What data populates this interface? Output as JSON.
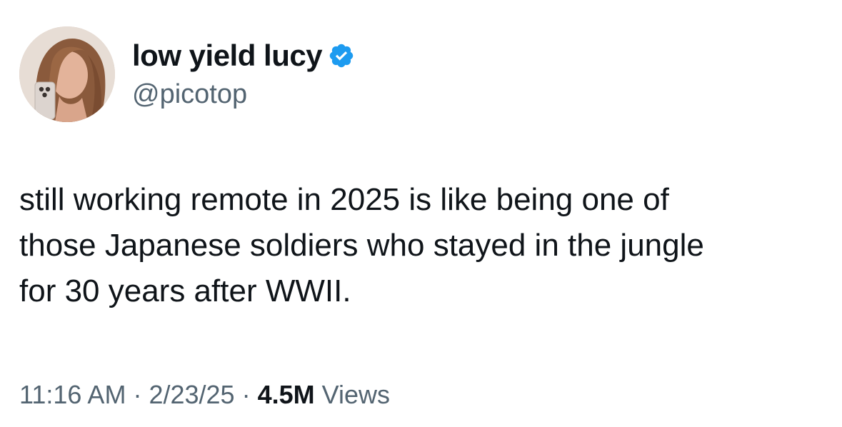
{
  "author": {
    "display_name": "low yield lucy",
    "handle": "@picotop",
    "avatar_icon": "profile-photo",
    "verified_icon": "verified-badge-icon",
    "verified_color": "#1d9bf0"
  },
  "tweet": {
    "text": "still working remote in 2025 is like being one of\nthose Japanese soldiers who stayed in the jungle\nfor 30 years after WWII."
  },
  "meta": {
    "time": "11:16 AM",
    "separator": "·",
    "date": "2/23/25",
    "views_count": "4.5M",
    "views_label": "Views"
  },
  "colors": {
    "text_primary": "#0f1419",
    "text_secondary": "#536471",
    "background": "#ffffff"
  }
}
